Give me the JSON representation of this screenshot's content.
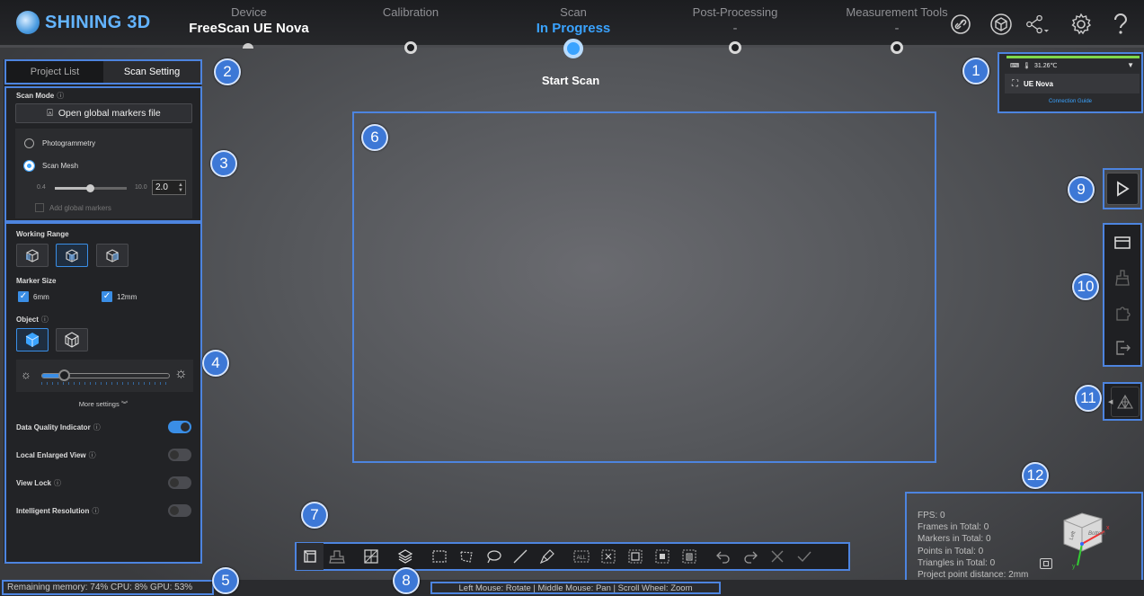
{
  "app": {
    "brand": "SHINING 3D"
  },
  "steps": [
    {
      "title": "Device",
      "sub": "FreeScan UE Nova"
    },
    {
      "title": "Calibration",
      "sub": ""
    },
    {
      "title": "Scan",
      "sub": "In Progress"
    },
    {
      "title": "Post-Processing",
      "sub": "-"
    },
    {
      "title": "Measurement Tools",
      "sub": "-"
    }
  ],
  "top_icons": [
    "link-icon",
    "model-icon",
    "share-icon",
    "gear-icon",
    "help-icon"
  ],
  "canvas": {
    "status": "Start Scan"
  },
  "device_panel": {
    "temperature": "31.26℃",
    "device_name": "UE Nova",
    "link": "Connection Guide"
  },
  "tabs": {
    "project_list": "Project List",
    "scan_setting": "Scan Setting"
  },
  "scan_mode": {
    "label": "Scan Mode",
    "open_markers": "Open global markers file",
    "opt_photogrammetry": "Photogrammetry",
    "opt_scan_mesh": "Scan Mesh",
    "selected": "Scan Mesh",
    "slider_min": "0.4",
    "slider_max": "10.0",
    "resolution_value": "2.0",
    "add_markers": "Add global markers"
  },
  "settings": {
    "working_range": "Working Range",
    "marker_size": "Marker Size",
    "marker_6": "6mm",
    "marker_12": "12mm",
    "object": "Object",
    "brightness_level": 0.17,
    "more": "More settings",
    "data_quality": "Data Quality Indicator",
    "local_view": "Local Enlarged View",
    "view_lock": "View Lock",
    "intelligent_res": "Intelligent Resolution"
  },
  "status": {
    "resources": "Remaining memory: 74% CPU: 8% GPU: 53%",
    "mouse_hint": "Left Mouse: Rotate | Middle Mouse: Pan | Scroll Wheel: Zoom"
  },
  "info": {
    "fps": "FPS: 0",
    "frames": "Frames in Total: 0",
    "markers": "Markers in Total: 0",
    "points": "Points in Total: 0",
    "triangles": "Triangles in Total: 0",
    "distance": "Project point distance: 2mm"
  },
  "axis": {
    "x": "x",
    "y": "y",
    "face_left": "Left",
    "face_front": "Bottom"
  },
  "callouts": [
    "1",
    "2",
    "3",
    "4",
    "5",
    "6",
    "7",
    "8",
    "9",
    "10",
    "11",
    "12"
  ],
  "colors": {
    "accent": "#3aa3ff",
    "callout": "#3d78d6",
    "highlight": "#4d84df"
  }
}
